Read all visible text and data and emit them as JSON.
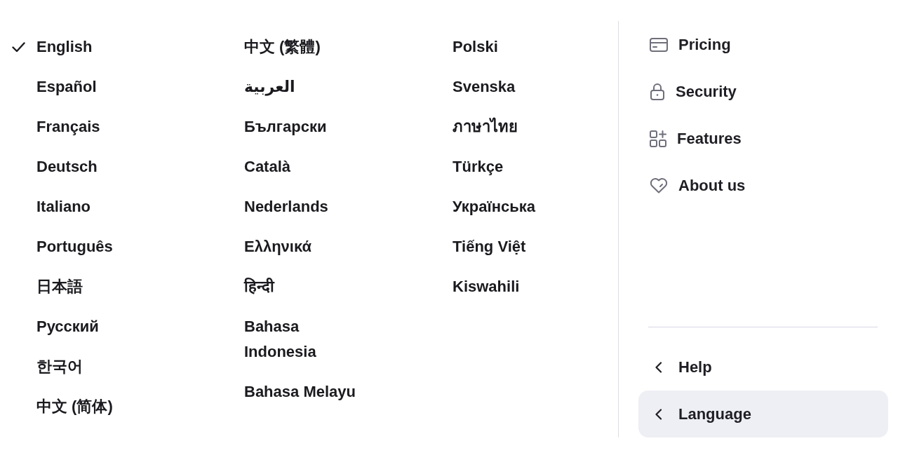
{
  "language_columns": [
    {
      "languages": [
        {
          "label": "English",
          "selected": true
        },
        {
          "label": "Español",
          "selected": false
        },
        {
          "label": "Français",
          "selected": false
        },
        {
          "label": "Deutsch",
          "selected": false
        },
        {
          "label": "Italiano",
          "selected": false
        },
        {
          "label": "Português",
          "selected": false
        },
        {
          "label": "日本語",
          "selected": false
        },
        {
          "label": "Русский",
          "selected": false
        },
        {
          "label": "한국어",
          "selected": false
        },
        {
          "label": "中文 (简体)",
          "selected": false
        }
      ]
    },
    {
      "languages": [
        {
          "label": "中文 (繁體)",
          "selected": false
        },
        {
          "label": "العربية",
          "selected": false
        },
        {
          "label": "Български",
          "selected": false
        },
        {
          "label": "Català",
          "selected": false
        },
        {
          "label": "Nederlands",
          "selected": false
        },
        {
          "label": "Ελληνικά",
          "selected": false
        },
        {
          "label": "हिन्दी",
          "selected": false
        },
        {
          "label": "Bahasa Indonesia",
          "selected": false
        },
        {
          "label": "Bahasa Melayu",
          "selected": false
        }
      ]
    },
    {
      "languages": [
        {
          "label": "Polski",
          "selected": false
        },
        {
          "label": "Svenska",
          "selected": false
        },
        {
          "label": "ภาษาไทย",
          "selected": false
        },
        {
          "label": "Türkçe",
          "selected": false
        },
        {
          "label": "Українська",
          "selected": false
        },
        {
          "label": "Tiếng Việt",
          "selected": false
        },
        {
          "label": "Kiswahili",
          "selected": false
        }
      ]
    }
  ],
  "nav_items": [
    {
      "label": "Pricing"
    },
    {
      "label": "Security"
    },
    {
      "label": "Features"
    },
    {
      "label": "About us"
    }
  ],
  "submenus": [
    {
      "label": "Help",
      "selected": false
    },
    {
      "label": "Language",
      "selected": true
    }
  ]
}
